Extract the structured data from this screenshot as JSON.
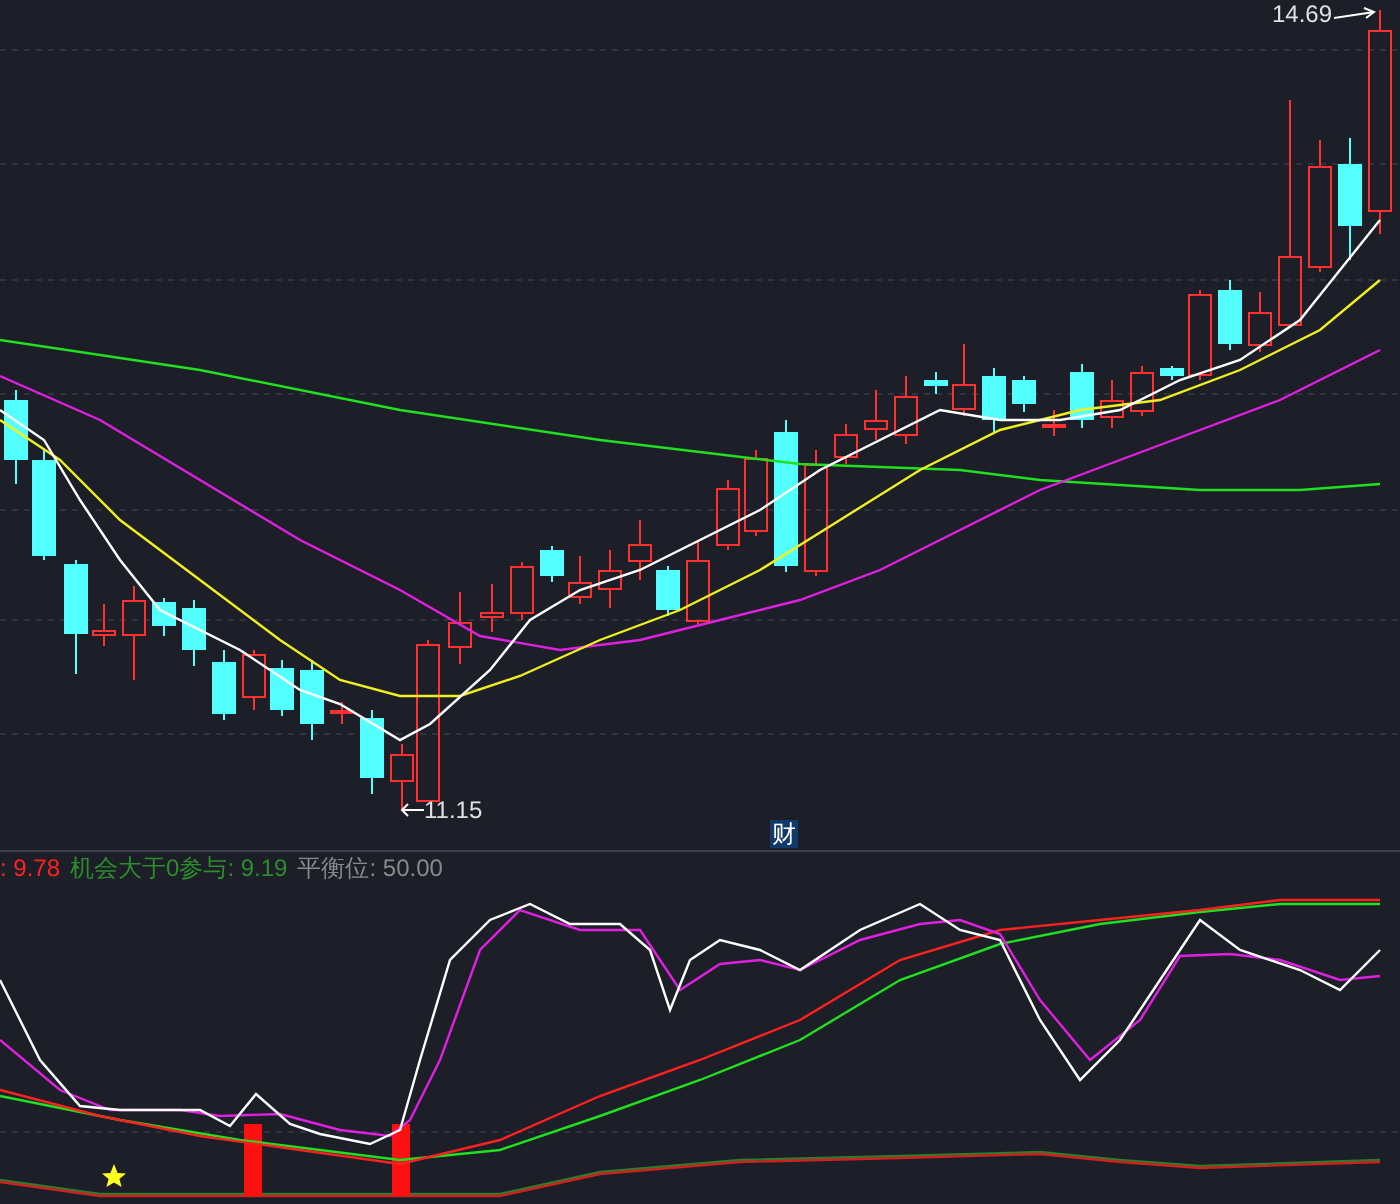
{
  "price_chart": {
    "high_label": "14.69",
    "low_label": "11.15",
    "marker": "财"
  },
  "indicator": {
    "legend": [
      {
        "text": ": 9.78",
        "color": "#ff2020"
      },
      {
        "text": "机会大于0参与: 9.19",
        "color": "#2e8b2e"
      },
      {
        "text": "平衡位: 50.00",
        "color": "#8a8a8a"
      }
    ]
  }
}
